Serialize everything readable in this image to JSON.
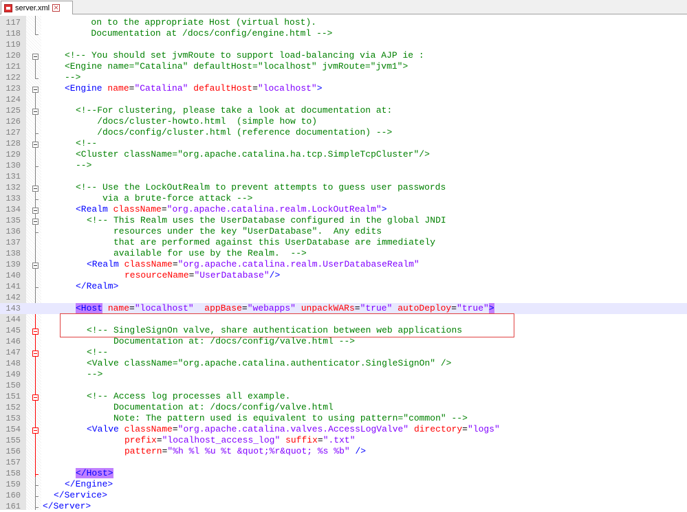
{
  "tab": {
    "filename": "server.xml"
  },
  "lines": {
    "117": {
      "n": "117",
      "text": "        on to the appropriate Host (virtual host)."
    },
    "118": {
      "n": "118",
      "text": "        Documentation at /docs/config/engine.html -->"
    },
    "119": {
      "n": "119"
    },
    "120": {
      "n": "120",
      "text": "<!-- You should set jvmRoute to support load-balancing via AJP ie :"
    },
    "121": {
      "n": "121",
      "text": "<Engine name=\"Catalina\" defaultHost=\"localhost\" jvmRoute=\"jvm1\">"
    },
    "122": {
      "n": "122",
      "text": "-->"
    },
    "123": {
      "n": "123",
      "tag": "<Engine",
      "a1": "name",
      "v1": "\"Catalina\"",
      "a2": "defaultHost",
      "v2": "\"localhost\"",
      "end": ">"
    },
    "124": {
      "n": "124"
    },
    "125": {
      "n": "125",
      "text": "<!--For clustering, please take a look at documentation at:"
    },
    "126": {
      "n": "126",
      "text": "    /docs/cluster-howto.html  (simple how to)"
    },
    "127": {
      "n": "127",
      "text": "    /docs/config/cluster.html (reference documentation) -->"
    },
    "128": {
      "n": "128",
      "text": "<!--"
    },
    "129": {
      "n": "129",
      "text": "<Cluster className=\"org.apache.catalina.ha.tcp.SimpleTcpCluster\"/>"
    },
    "130": {
      "n": "130",
      "text": "-->"
    },
    "131": {
      "n": "131"
    },
    "132": {
      "n": "132",
      "text": "<!-- Use the LockOutRealm to prevent attempts to guess user passwords"
    },
    "133": {
      "n": "133",
      "text": "     via a brute-force attack -->"
    },
    "134": {
      "n": "134",
      "tag": "<Realm",
      "a1": "className",
      "v1": "\"org.apache.catalina.realm.LockOutRealm\"",
      "end": ">"
    },
    "135": {
      "n": "135",
      "text": "<!-- This Realm uses the UserDatabase configured in the global JNDI"
    },
    "136": {
      "n": "136",
      "text": "     resources under the key \"UserDatabase\".  Any edits"
    },
    "137": {
      "n": "137",
      "text": "     that are performed against this UserDatabase are immediately"
    },
    "138": {
      "n": "138",
      "text": "     available for use by the Realm.  -->"
    },
    "139": {
      "n": "139",
      "tag": "<Realm",
      "a1": "className",
      "v1": "\"org.apache.catalina.realm.UserDatabaseRealm\""
    },
    "140": {
      "n": "140",
      "a1": "resourceName",
      "v1": "\"UserDatabase\"",
      "end": "/>"
    },
    "141": {
      "n": "141",
      "tag": "</Realm>"
    },
    "142": {
      "n": "142"
    },
    "143": {
      "n": "143",
      "tag": "<Host",
      "a1": "name",
      "v1": "\"localhost\"",
      "a2": "appBase",
      "v2": "\"webapps\"",
      "a3": "unpackWARs",
      "v3": "\"true\"",
      "a4": "autoDeploy",
      "v4": "\"true\"",
      "end": ">"
    },
    "144": {
      "n": "144"
    },
    "145": {
      "n": "145",
      "text": "<!-- SingleSignOn valve, share authentication between web applications"
    },
    "146": {
      "n": "146",
      "text": "     Documentation at: /docs/config/valve.html -->"
    },
    "147": {
      "n": "147",
      "text": "<!--"
    },
    "148": {
      "n": "148",
      "text": "<Valve className=\"org.apache.catalina.authenticator.SingleSignOn\" />"
    },
    "149": {
      "n": "149",
      "text": "-->"
    },
    "150": {
      "n": "150"
    },
    "151": {
      "n": "151",
      "text": "<!-- Access log processes all example."
    },
    "152": {
      "n": "152",
      "text": "     Documentation at: /docs/config/valve.html"
    },
    "153": {
      "n": "153",
      "text": "     Note: The pattern used is equivalent to using pattern=\"common\" -->"
    },
    "154": {
      "n": "154",
      "tag": "<Valve",
      "a1": "className",
      "v1": "\"org.apache.catalina.valves.AccessLogValve\"",
      "a2": "directory",
      "v2": "\"logs\""
    },
    "155": {
      "n": "155",
      "a1": "prefix",
      "v1": "\"localhost_access_log\"",
      "a2": "suffix",
      "v2": "\".txt\""
    },
    "156": {
      "n": "156",
      "a1": "pattern",
      "v1": "\"%h %l %u %t &quot;%r&quot; %s %b\"",
      "end": " />"
    },
    "157": {
      "n": "157"
    },
    "158": {
      "n": "158",
      "tag": "</Host>"
    },
    "159": {
      "n": "159",
      "tag": "</Engine>"
    },
    "160": {
      "n": "160",
      "tag": "</Service>"
    },
    "161": {
      "n": "161",
      "tag": "</Server>"
    }
  },
  "colors": {
    "comment": "#008000",
    "tag": "#0000ff",
    "attr": "#ff0000",
    "value": "#8000ff",
    "highlight": "#c080ff",
    "current_line": "#e8e8ff",
    "selection_box": "#e04040"
  }
}
